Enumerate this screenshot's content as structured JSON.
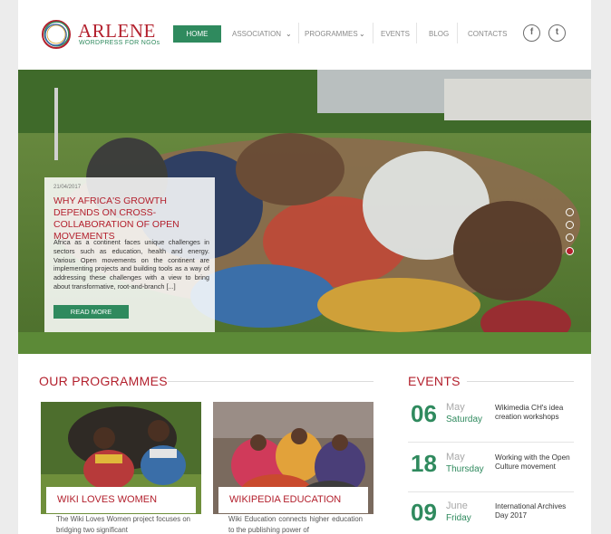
{
  "brand": {
    "name": "ARLENE",
    "tagline": "WORDPRESS FOR NGOs"
  },
  "nav": {
    "home": "HOME",
    "association": "ASSOCIATION",
    "programmes": "PROGRAMMES",
    "events": "EVENTS",
    "blog": "BLOG",
    "contacts": "CONTACTS"
  },
  "social": {
    "facebook_icon": "f",
    "twitter_icon": "t"
  },
  "hero": {
    "date": "21/04/2017",
    "title": "WHY AFRICA'S GROWTH DEPENDS ON CROSS-COLLABORATION OF OPEN MOVEMENTS",
    "excerpt": "Africa as a continent faces unique challenges in sectors such as education, health and energy. Various Open movements on the continent are implementing projects and building tools as a way of addressing these challenges with a view to bring about transformative, root-and-branch [...]",
    "button": "READ MORE",
    "slider": {
      "slides": 4,
      "active": 3
    }
  },
  "programmes": {
    "title": "OUR PROGRAMMES",
    "items": [
      {
        "label": "WIKI LOVES WOMEN",
        "desc": "The Wiki Loves Women project focuses on bridging two significant"
      },
      {
        "label": "WIKIPEDIA EDUCATION",
        "desc": "Wiki Education connects higher education to the publishing power of"
      }
    ]
  },
  "events": {
    "title": "EVENTS",
    "items": [
      {
        "day": "06",
        "month": "May",
        "weekday": "Saturday",
        "title": "Wikimedia CH's idea creation workshops"
      },
      {
        "day": "18",
        "month": "May",
        "weekday": "Thursday",
        "title": "Working with the Open Culture movement"
      },
      {
        "day": "09",
        "month": "June",
        "weekday": "Friday",
        "title": "International Archives Day 2017"
      }
    ]
  },
  "colors": {
    "accent_green": "#2f8a5e",
    "brand_red": "#b3202d"
  }
}
